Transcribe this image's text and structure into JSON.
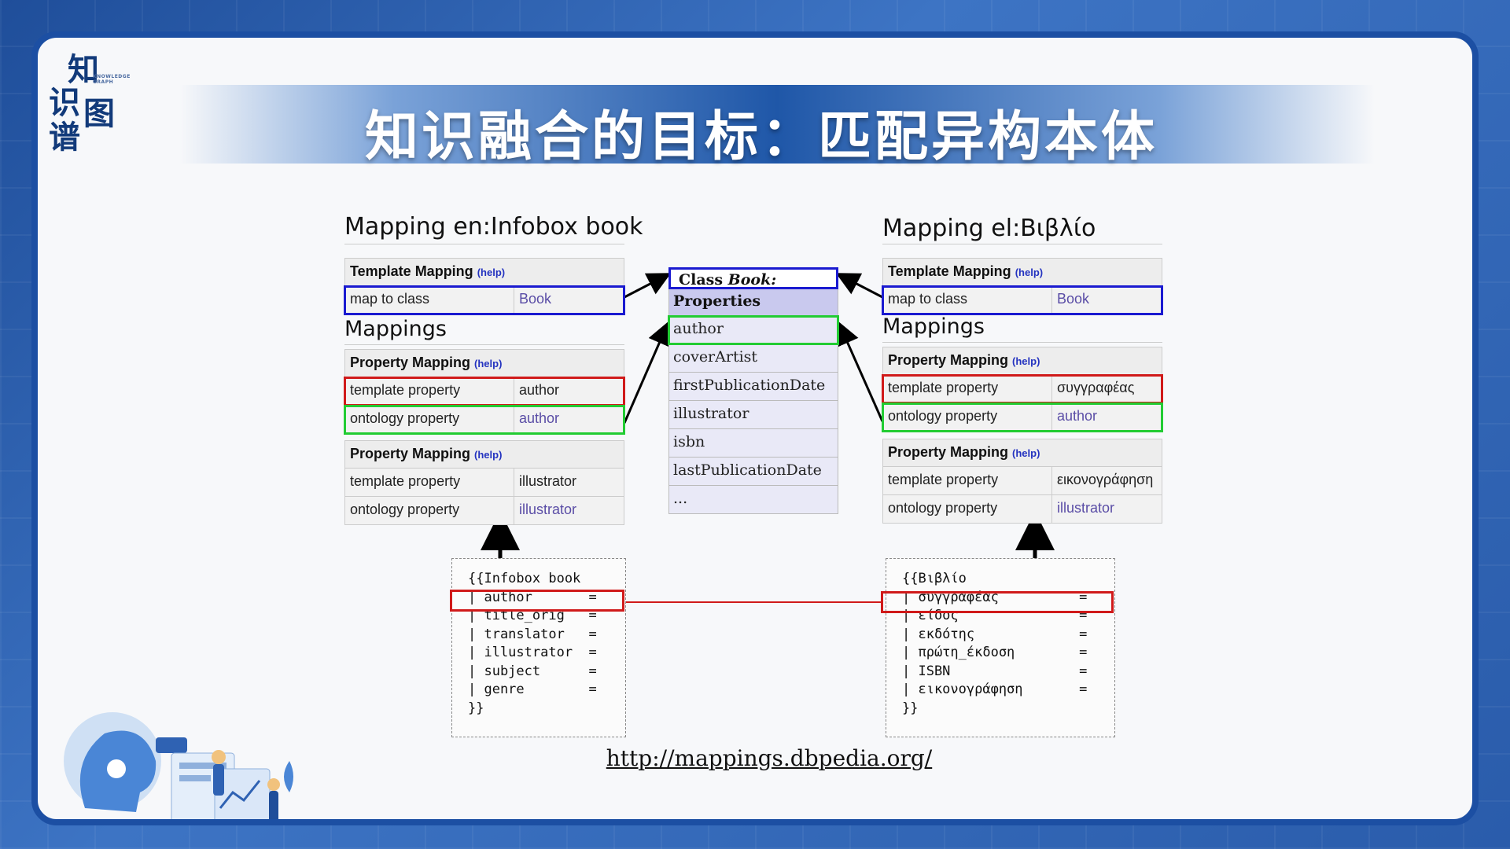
{
  "slide": {
    "logo": {
      "chars": [
        "知",
        "识",
        "图",
        "谱"
      ],
      "small_text": "KNOWLEDGE GRAPH"
    },
    "title": "知识融合的目标：匹配异构本体"
  },
  "left_mapping": {
    "heading": "Mapping en:Infobox book",
    "template_mapping": {
      "label": "Template Mapping",
      "help": "(help)",
      "map_to_class_label": "map to class",
      "map_to_class_value": "Book"
    },
    "mappings_heading": "Mappings",
    "property_mappings": [
      {
        "label": "Property Mapping",
        "help": "(help)",
        "template_property_label": "template property",
        "template_property_value": "author",
        "ontology_property_label": "ontology property",
        "ontology_property_value": "author"
      },
      {
        "label": "Property Mapping",
        "help": "(help)",
        "template_property_label": "template property",
        "template_property_value": "illustrator",
        "ontology_property_label": "ontology property",
        "ontology_property_value": "illustrator"
      }
    ]
  },
  "right_mapping": {
    "heading": "Mapping el:Βιβλίο",
    "template_mapping": {
      "label": "Template Mapping",
      "help": "(help)",
      "map_to_class_label": "map to class",
      "map_to_class_value": "Book"
    },
    "mappings_heading": "Mappings",
    "property_mappings": [
      {
        "label": "Property Mapping",
        "help": "(help)",
        "template_property_label": "template property",
        "template_property_value": "συγγραφέας",
        "ontology_property_label": "ontology property",
        "ontology_property_value": "author"
      },
      {
        "label": "Property Mapping",
        "help": "(help)",
        "template_property_label": "template property",
        "template_property_value": "εικονογράφηση",
        "ontology_property_label": "ontology property",
        "ontology_property_value": "illustrator"
      }
    ]
  },
  "class_box": {
    "title_prefix": "Class ",
    "title_name": "Book:",
    "properties_label": "Properties",
    "properties": [
      "author",
      "coverArtist",
      "firstPublicationDate",
      "illustrator",
      "isbn",
      "lastPublicationDate",
      "..."
    ]
  },
  "left_code": {
    "lines": [
      "{{Infobox book",
      "| author       =",
      "| title_orig   =",
      "| translator   =",
      "| illustrator  =",
      "| subject      =",
      "| genre        =",
      "}}"
    ]
  },
  "right_code": {
    "lines": [
      "{{Βιβλίο",
      "| συγγραφέας          =",
      "| είδος               =",
      "| εκδότης             =",
      "| πρώτη_έκδοση        =",
      "| ISBN                =",
      "| εικονογράφηση       =",
      "}}"
    ]
  },
  "footer": {
    "url": "http://mappings.dbpedia.org/"
  },
  "colors": {
    "blue_box": "#1a1ad0",
    "red_box": "#d01a1a",
    "green_box": "#22cc33",
    "title_bar": "#1f57a8",
    "frame": "#1c4fa3"
  },
  "icons": [
    "ai-illustration"
  ]
}
